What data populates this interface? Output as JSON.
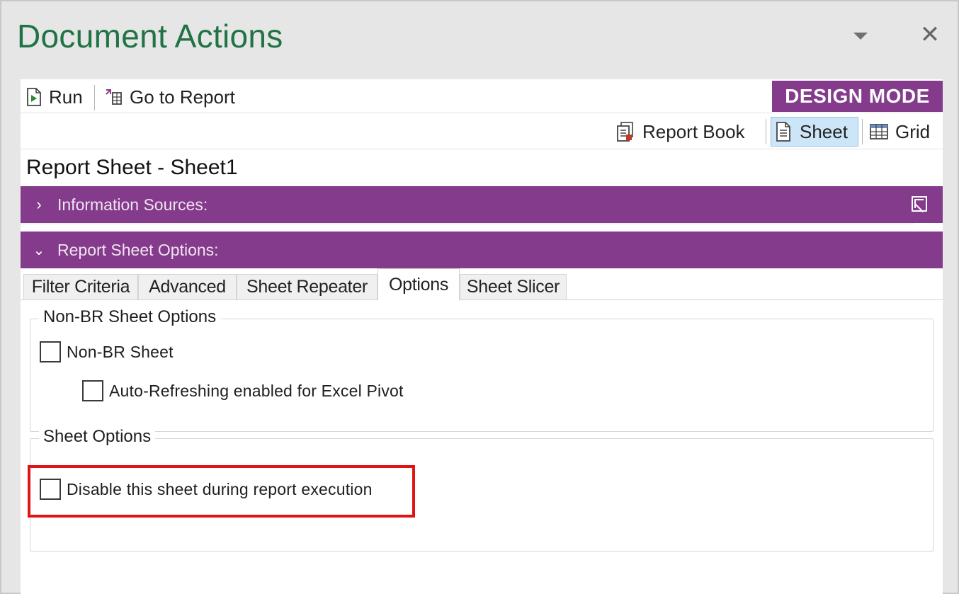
{
  "pane": {
    "title": "Document Actions",
    "dropdown_icon": "chevron-down-icon",
    "close_glyph": "✕"
  },
  "toolbar": {
    "run_label": "Run",
    "run_icon": "run-icon",
    "go_to_report_label": "Go to Report",
    "go_to_report_icon": "go-to-report-icon",
    "mode_badge": "DESIGN MODE",
    "view_buttons": [
      {
        "label": "Report Book",
        "icon": "report-book-icon"
      },
      {
        "label": "Sheet",
        "icon": "sheet-icon",
        "selected": true
      },
      {
        "label": "Grid",
        "icon": "grid-icon"
      }
    ]
  },
  "sheet_heading": "Report Sheet - Sheet1",
  "sections": {
    "information_sources": "Information Sources:",
    "report_sheet_options": "Report Sheet Options:"
  },
  "tabs": [
    {
      "label": "Filter Criteria"
    },
    {
      "label": "Advanced"
    },
    {
      "label": "Sheet Repeater"
    },
    {
      "label": "Options",
      "selected": true
    },
    {
      "label": "Sheet Slicer"
    }
  ],
  "options_tab": {
    "non_br_group": {
      "legend": "Non-BR Sheet Options",
      "non_br_sheet": {
        "label": "Non-BR Sheet",
        "checked": false
      },
      "auto_refresh": {
        "label": "Auto-Refreshing enabled for Excel Pivot",
        "checked": false
      }
    },
    "sheet_options_group": {
      "legend": "Sheet Options",
      "disable_sheet": {
        "label": "Disable this sheet during report execution",
        "checked": false
      }
    }
  },
  "colors": {
    "title_green": "#217346",
    "accent_purple": "#853b8b",
    "selected_blue": "#cde6f7",
    "highlight_red": "#e01414"
  }
}
